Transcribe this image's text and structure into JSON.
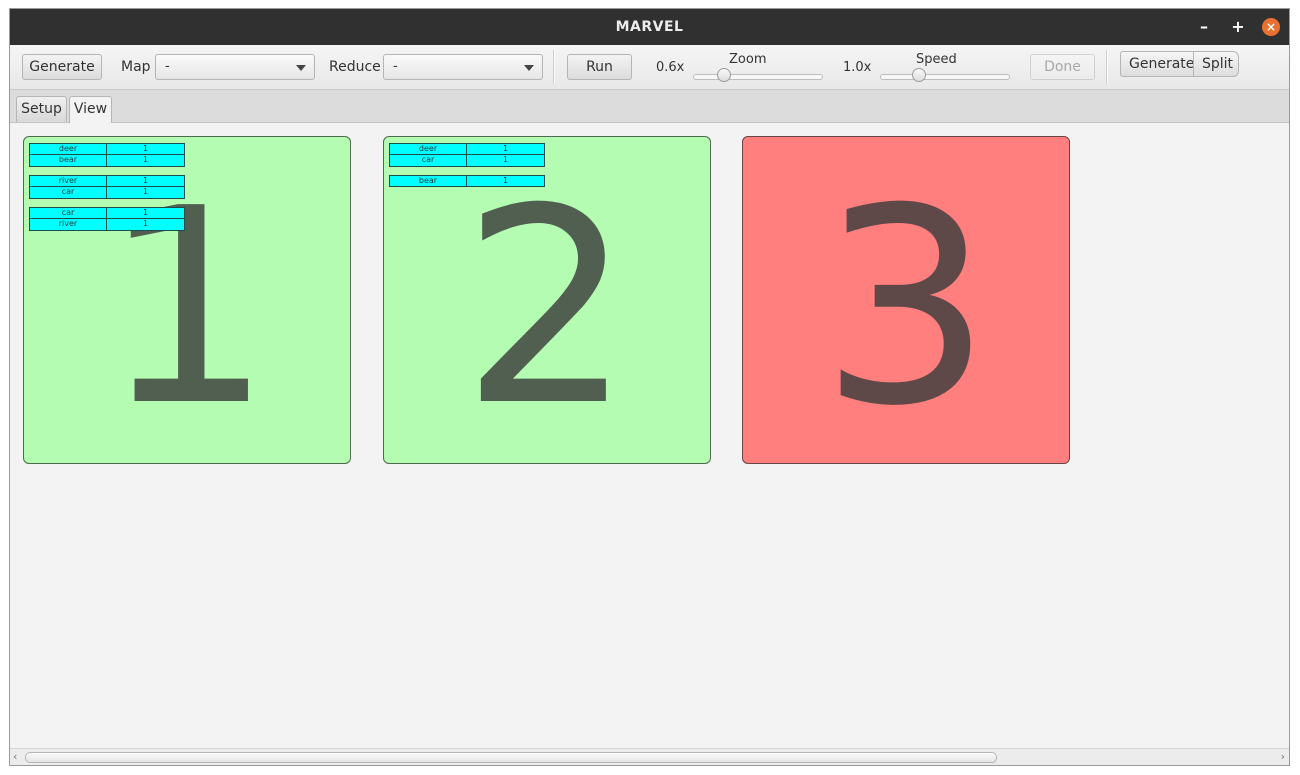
{
  "window": {
    "title": "MARVEL",
    "minimize": "–",
    "maximize": "+",
    "close": "×"
  },
  "toolbar": {
    "generate_label": "Generate",
    "map_label": "Map",
    "map_value": "-",
    "reduce_label": "Reduce",
    "reduce_value": "-",
    "run_label": "Run",
    "zoom_value": "0.6x",
    "zoom_label": "Zoom",
    "speed_value": "1.0x",
    "speed_label": "Speed",
    "done_label": "Done",
    "breadcrumb": [
      "Generate",
      "Split"
    ]
  },
  "tabs": [
    {
      "label": "Setup",
      "active": false
    },
    {
      "label": "View",
      "active": true
    }
  ],
  "nodes": [
    {
      "number": "1",
      "status": "green",
      "groups": [
        [
          [
            "deer",
            "1"
          ],
          [
            "bear",
            "1"
          ]
        ],
        [
          [
            "river",
            "1"
          ],
          [
            "car",
            "1"
          ]
        ],
        [
          [
            "car",
            "1"
          ],
          [
            "river",
            "1"
          ]
        ]
      ]
    },
    {
      "number": "2",
      "status": "green",
      "groups": [
        [
          [
            "deer",
            "1"
          ],
          [
            "car",
            "1"
          ]
        ],
        [
          [
            "bear",
            "1"
          ]
        ]
      ]
    },
    {
      "number": "3",
      "status": "red",
      "groups": []
    }
  ],
  "colors": {
    "node_ok": "#b3fcb2",
    "node_fail": "#ff7f7f",
    "kv_cell": "#00ffff",
    "close_button": "#e9712f"
  }
}
